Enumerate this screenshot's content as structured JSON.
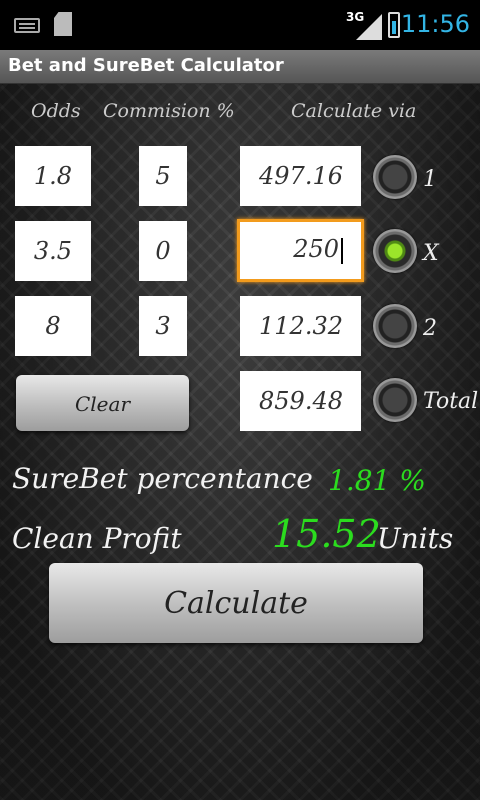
{
  "status_bar": {
    "network": "3G",
    "time": "11:56"
  },
  "app_title": "Bet and SureBet Calculator",
  "headers": {
    "odds": "Odds",
    "commission": "Commision %",
    "calculate_via": "Calculate via"
  },
  "rows": [
    {
      "odds": "1.8",
      "commission": "5",
      "stake": "497.16",
      "option": "1"
    },
    {
      "odds": "3.5",
      "commission": "0",
      "stake": "250",
      "option": "X"
    },
    {
      "odds": "8",
      "commission": "3",
      "stake": "112.32",
      "option": "2"
    }
  ],
  "total": {
    "stake": "859.48",
    "option": "Total"
  },
  "selected_option": "X",
  "clear_label": "Clear",
  "surebet": {
    "label": "SureBet percentance",
    "value": "1.81 %"
  },
  "profit": {
    "label": "Clean Profit",
    "value": "15.52",
    "unit": "Units"
  },
  "calculate_label": "Calculate",
  "colors": {
    "accent_green": "#2bdc1e",
    "focus_orange": "#f29b1d",
    "status_blue": "#33b5e5"
  }
}
